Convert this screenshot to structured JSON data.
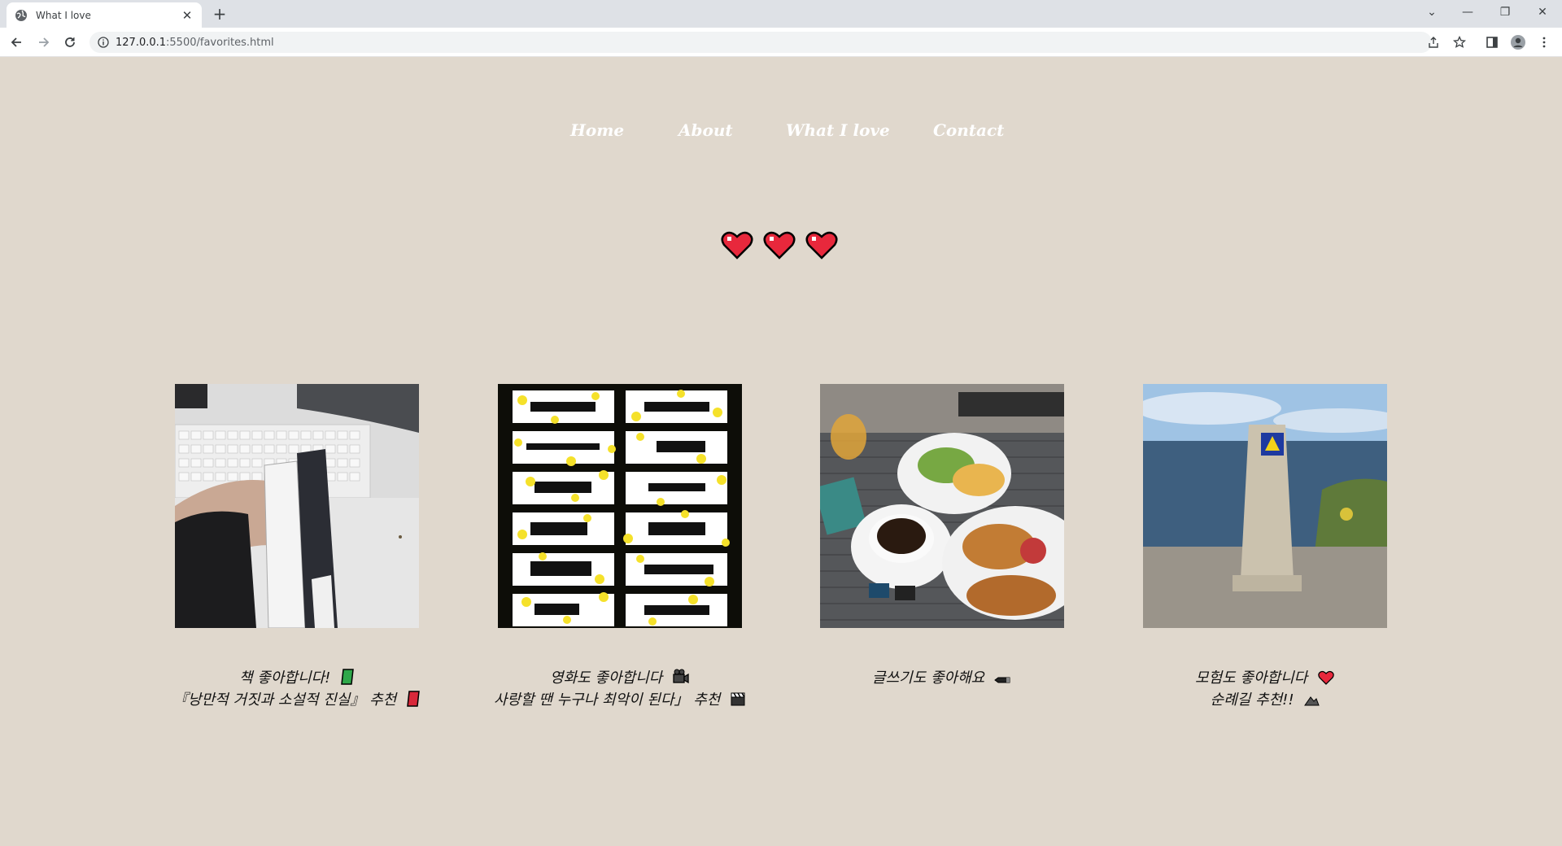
{
  "browser": {
    "tab_title": "What I love",
    "tab_close": "✕",
    "new_tab": "+",
    "url_host": "127.0.0.1",
    "url_path": ":5500/favorites.html",
    "controls": {
      "dropdown": "⌄",
      "minimize": "—",
      "restore": "❐",
      "close": "✕"
    }
  },
  "nav": {
    "items": [
      {
        "label": "Home"
      },
      {
        "label": "About"
      },
      {
        "label": "What I love"
      },
      {
        "label": "Contact"
      }
    ]
  },
  "hearts": {
    "count": 3,
    "color": "#e8283c"
  },
  "cards": [
    {
      "alt": "books",
      "lines": [
        "책 좋아합니다! ",
        "『낭만적 거짓과 소설적 진실』 추천 "
      ],
      "emojis": [
        "green-book-icon",
        "red-book-icon"
      ]
    },
    {
      "alt": "movies",
      "lines": [
        "영화도 좋아합니다 ",
        "사랑할 땐 누구나 최악이 된다」 추천 "
      ],
      "emojis": [
        "video-camera-icon",
        "clapper-board-icon"
      ]
    },
    {
      "alt": "writing",
      "lines": [
        "글쓰기도 좋아해요 "
      ],
      "emojis": [
        "pen-icon"
      ]
    },
    {
      "alt": "adventure",
      "lines": [
        "모험도 좋아합니다 ",
        "순례길 추천!! "
      ],
      "emojis": [
        "heart-icon",
        "hiking-icon"
      ]
    }
  ],
  "colors": {
    "background": "#e0d8cd",
    "nav_text": "#ffffff",
    "caption_text": "#111111"
  }
}
